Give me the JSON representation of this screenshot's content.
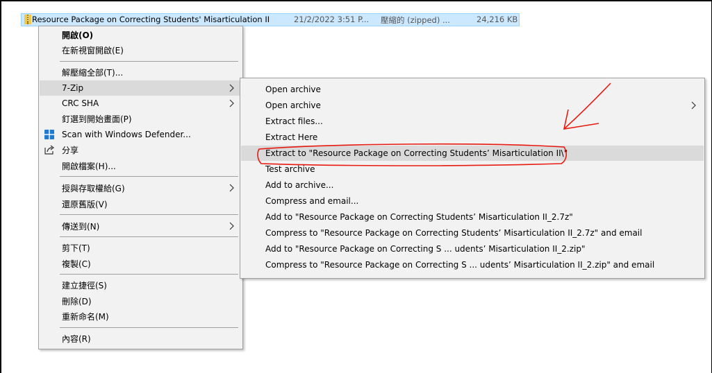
{
  "file": {
    "name": "Resource Package on Correcting Students' Misarticulation II",
    "date": "21/2/2022 3:51 P...",
    "type": "壓縮的 (zipped) ...",
    "size": "24,216 KB"
  },
  "context_menu": {
    "items": [
      {
        "label": "開啟(O)",
        "bold": true
      },
      {
        "label": "在新視窗開啟(E)"
      },
      {
        "label": "解壓縮全部(T)..."
      },
      {
        "label": "7-Zip",
        "submenu": true,
        "highlighted": true
      },
      {
        "label": "CRC SHA",
        "submenu": true
      },
      {
        "label": "釘選到開始畫面(P)"
      },
      {
        "label": "Scan with Windows Defender...",
        "icon": "windows-defender-icon"
      },
      {
        "label": "分享",
        "icon": "share-icon"
      },
      {
        "label": "開啟檔案(H)..."
      },
      {
        "label": "授與存取權給(G)",
        "submenu": true
      },
      {
        "label": "還原舊版(V)"
      },
      {
        "label": "傳送到(N)",
        "submenu": true
      },
      {
        "label": "剪下(T)"
      },
      {
        "label": "複製(C)"
      },
      {
        "label": "建立捷徑(S)"
      },
      {
        "label": "刪除(D)"
      },
      {
        "label": "重新命名(M)"
      },
      {
        "label": "內容(R)"
      }
    ]
  },
  "submenu_7zip": {
    "items": [
      {
        "label": "Open archive"
      },
      {
        "label": "Open archive",
        "submenu": true
      },
      {
        "label": "Extract files..."
      },
      {
        "label": "Extract Here"
      },
      {
        "label": "Extract to \"Resource Package on Correcting Students’ Misarticulation II\\\"",
        "highlighted": true
      },
      {
        "label": "Test archive"
      },
      {
        "label": "Add to archive..."
      },
      {
        "label": "Compress and email..."
      },
      {
        "label": "Add to \"Resource Package on Correcting Students’ Misarticulation II_2.7z\""
      },
      {
        "label": "Compress to \"Resource Package on Correcting Students’ Misarticulation II_2.7z\" and email"
      },
      {
        "label": "Add to \"Resource Package on Correcting S ... udents’ Misarticulation II_2.zip\""
      },
      {
        "label": "Compress to \"Resource Package on Correcting S ... udents’ Misarticulation II_2.zip\" and email"
      }
    ]
  },
  "colors": {
    "selection": "#cce8ff",
    "menu_bg": "#f2f2f2",
    "menu_highlight": "#dadada",
    "annotation": "#e8190f"
  }
}
